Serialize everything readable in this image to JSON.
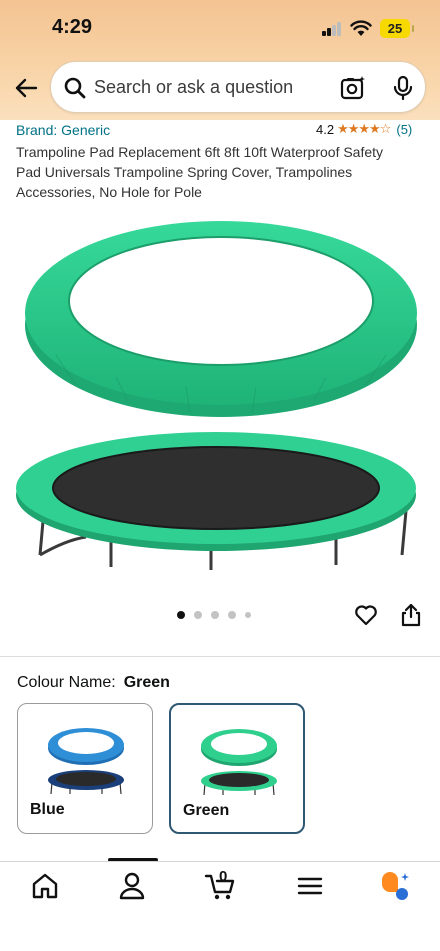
{
  "status_bar": {
    "time": "4:29",
    "battery_level": "25"
  },
  "search": {
    "placeholder": "Search or ask a question"
  },
  "product": {
    "brand": "Brand: Generic",
    "rating_value": "4.2",
    "stars_display": "★★★★☆",
    "rating_count": "(5)",
    "title": "Trampoline Pad Replacement 6ft 8ft 10ft Waterproof Safety Pad Universals Trampoline Spring Cover, Trampolines Accessories, No Hole for Pole"
  },
  "carousel": {
    "image_count": 5,
    "active_index": 0
  },
  "colour": {
    "label": "Colour Name:",
    "selected": "Green",
    "options": [
      {
        "name": "Blue",
        "pad_color": "#2f8fd6",
        "selected": false
      },
      {
        "name": "Green",
        "pad_color": "#2fcf8e",
        "selected": true
      }
    ]
  },
  "bottom_nav": {
    "items": [
      "home-icon",
      "account-icon",
      "cart-icon",
      "menu-icon",
      "rufus-icon"
    ],
    "cart_count": "0",
    "active_index": 1
  },
  "colors": {
    "link": "#007185",
    "star": "#de7921",
    "pad_green": "#2fcf8e",
    "header_gradient_top": "#f4c392"
  }
}
